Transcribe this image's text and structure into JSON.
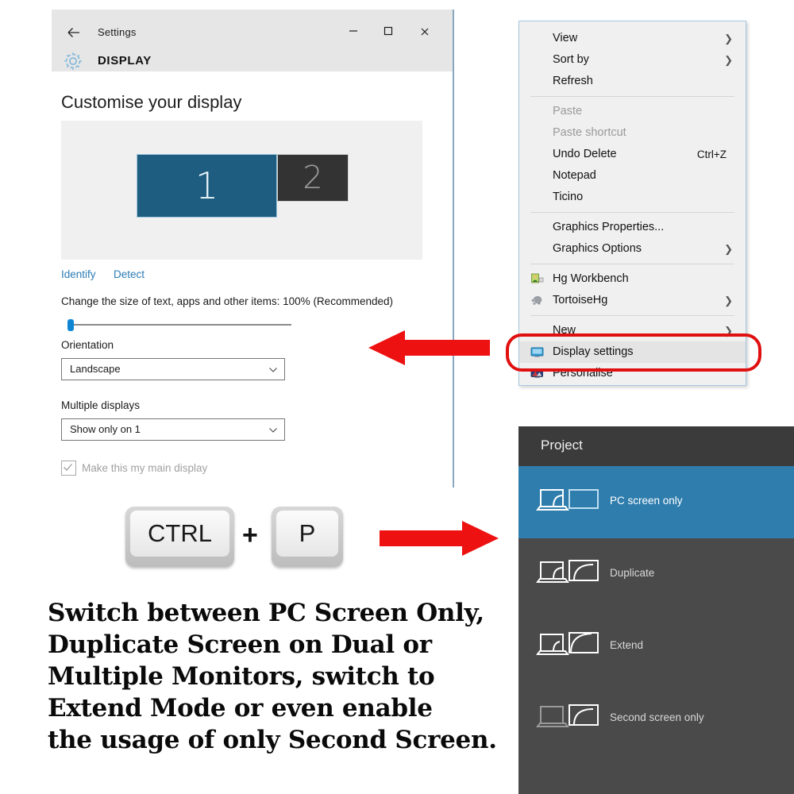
{
  "settings_window": {
    "titlebar": {
      "back_icon": "back-arrow-icon",
      "title": "Settings",
      "minimize": "–",
      "maximize": "☐",
      "close": "✕"
    },
    "section_icon": "gear-icon",
    "section_title": "DISPLAY",
    "heading": "Customise your display",
    "monitors": [
      {
        "number": "1",
        "state": "selected"
      },
      {
        "number": "2",
        "state": "unselected"
      }
    ],
    "links": {
      "identify": "Identify",
      "detect": "Detect"
    },
    "scale": {
      "label": "Change the size of text, apps and other items: 100% (Recommended)",
      "value": "100%",
      "position_percent": 0
    },
    "orientation": {
      "label": "Orientation",
      "value": "Landscape",
      "arrow_icon": "chevron-down-icon"
    },
    "multiple_displays": {
      "label": "Multiple displays",
      "value": "Show only on 1",
      "arrow_icon": "chevron-down-icon"
    },
    "main_display_checkbox": {
      "label": "Make this my main display",
      "checked": true,
      "disabled": true
    },
    "colors": {
      "titlebar_bg": "#e6e6e6",
      "monitor1_bg": "#1f5d80",
      "monitor2_bg": "#333333",
      "accent": "#0e86d4",
      "link": "#2b7cb5"
    }
  },
  "context_menu": {
    "items": [
      {
        "label": "View",
        "submenu": true,
        "disabled": false,
        "shortcut": "",
        "icon": ""
      },
      {
        "label": "Sort by",
        "submenu": true,
        "disabled": false,
        "shortcut": "",
        "icon": ""
      },
      {
        "label": "Refresh",
        "submenu": false,
        "disabled": false,
        "shortcut": "",
        "icon": ""
      },
      {
        "separator": true
      },
      {
        "label": "Paste",
        "submenu": false,
        "disabled": true,
        "shortcut": "",
        "icon": ""
      },
      {
        "label": "Paste shortcut",
        "submenu": false,
        "disabled": true,
        "shortcut": "",
        "icon": ""
      },
      {
        "label": "Undo Delete",
        "submenu": false,
        "disabled": false,
        "shortcut": "Ctrl+Z",
        "icon": ""
      },
      {
        "label": "Notepad",
        "submenu": false,
        "disabled": false,
        "shortcut": "",
        "icon": ""
      },
      {
        "label": "Ticino",
        "submenu": false,
        "disabled": false,
        "shortcut": "",
        "icon": ""
      },
      {
        "separator": true
      },
      {
        "label": "Graphics Properties...",
        "submenu": false,
        "disabled": false,
        "shortcut": "",
        "icon": ""
      },
      {
        "label": "Graphics Options",
        "submenu": true,
        "disabled": false,
        "shortcut": "",
        "icon": ""
      },
      {
        "separator": true
      },
      {
        "label": "Hg Workbench",
        "submenu": false,
        "disabled": false,
        "shortcut": "",
        "icon": "hg-workbench-icon"
      },
      {
        "label": "TortoiseHg",
        "submenu": true,
        "disabled": false,
        "shortcut": "",
        "icon": "tortoisehg-icon"
      },
      {
        "separator": true
      },
      {
        "label": "New",
        "submenu": true,
        "disabled": false,
        "shortcut": "",
        "icon": ""
      },
      {
        "label": "Display settings",
        "submenu": false,
        "disabled": false,
        "shortcut": "",
        "icon": "monitor-icon",
        "highlighted": true
      },
      {
        "label": "Personalise",
        "submenu": false,
        "disabled": false,
        "shortcut": "",
        "icon": "personalise-icon"
      }
    ],
    "highlight_color": "#e01010",
    "chevron_icon": "chevron-right-icon"
  },
  "project_panel": {
    "title": "Project",
    "selected_color": "#2e7dad",
    "options": [
      {
        "label": "PC screen only",
        "icon": "laptop-only-icon",
        "selected": true
      },
      {
        "label": "Duplicate",
        "icon": "duplicate-icon",
        "selected": false
      },
      {
        "label": "Extend",
        "icon": "extend-icon",
        "selected": false
      },
      {
        "label": "Second screen only",
        "icon": "second-screen-icon",
        "selected": false
      }
    ]
  },
  "shortcut": {
    "key1": "CTRL",
    "plus": "+",
    "key2": "P"
  },
  "arrows": {
    "left_arrow": "arrow-left-icon",
    "right_arrow": "arrow-right-icon",
    "color": "#ee1111"
  },
  "caption": {
    "lines": [
      "Switch between PC Screen Only,",
      "Duplicate Screen on Dual or",
      "Multiple Monitors, switch to",
      "Extend Mode or even enable",
      "the usage of only Second Screen."
    ]
  }
}
